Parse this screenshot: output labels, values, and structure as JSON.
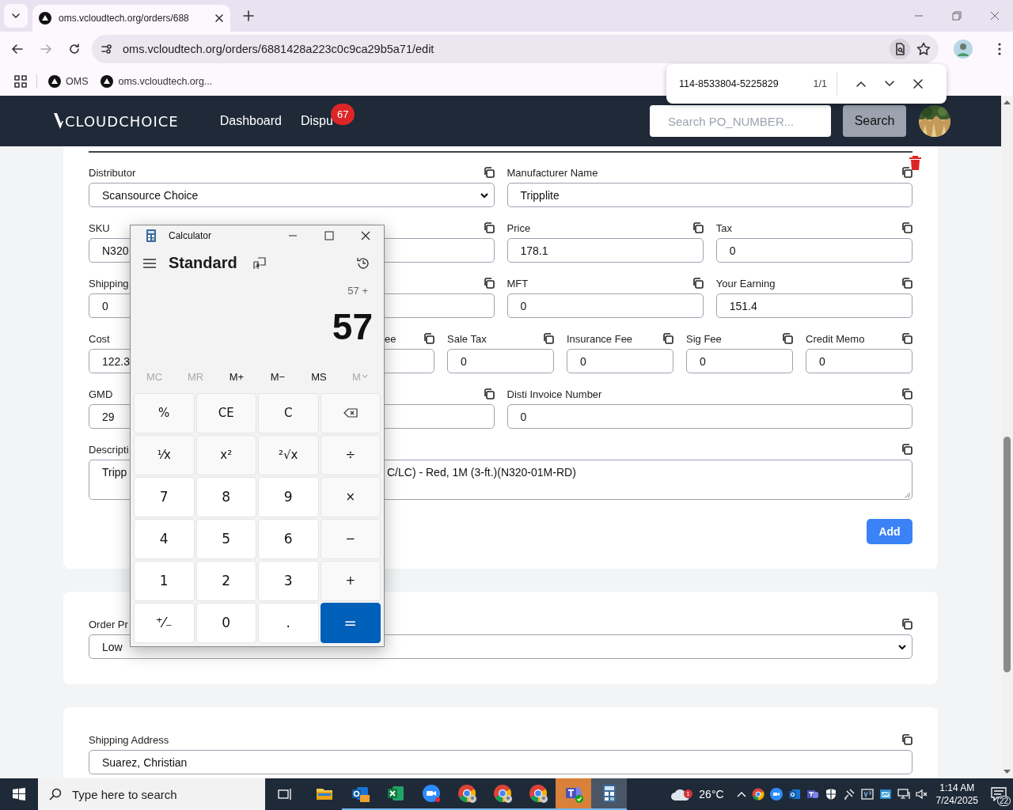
{
  "browser": {
    "tab_title": "oms.vcloudtech.org/orders/688",
    "url": "oms.vcloudtech.org/orders/6881428a223c0c9ca29b5a71/edit",
    "bookmarks": [
      "OMS",
      "oms.vcloudtech.org..."
    ],
    "find_bar": {
      "query": "114-8533804-5225829",
      "count": "1/1"
    }
  },
  "header": {
    "logo": "CLOUDCHOICE",
    "nav": [
      {
        "label": "Dashboard"
      },
      {
        "label": "Dispu",
        "badge": "67"
      }
    ],
    "search": {
      "placeholder": "Search PO_NUMBER..."
    },
    "search_button": "Search"
  },
  "order_card": {
    "rows": [
      {
        "fields": [
          {
            "kind": "select",
            "label": "Distributor",
            "value": "Scansource Choice"
          },
          {
            "kind": "input",
            "label": "Manufacturer Name",
            "value": "Tripplite"
          }
        ]
      },
      {
        "fields": [
          {
            "kind": "partial",
            "label": "SKU",
            "value": "N320"
          },
          {
            "kind": "covered"
          },
          {
            "kind": "input",
            "label": "Price",
            "value": "178.1"
          },
          {
            "kind": "input",
            "label": "Tax",
            "value": "0"
          }
        ]
      },
      {
        "fields": [
          {
            "kind": "partial",
            "label": "Shipping",
            "value": "0"
          },
          {
            "kind": "covered"
          },
          {
            "kind": "input",
            "label": "MFT",
            "value": "0"
          },
          {
            "kind": "input",
            "label": "Your Earning",
            "value": "151.4"
          }
        ]
      },
      {
        "fields": [
          {
            "kind": "partial",
            "label": "Cost",
            "value": "122.3"
          },
          {
            "kind": "hidden"
          },
          {
            "kind": "covered",
            "label": "ee"
          },
          {
            "kind": "input",
            "label": "Sale Tax",
            "value": "0"
          },
          {
            "kind": "input",
            "label": "Insurance Fee",
            "value": "0"
          },
          {
            "kind": "input",
            "label": "Sig Fee",
            "value": "0"
          },
          {
            "kind": "input",
            "label": "Credit Memo",
            "value": "0"
          }
        ]
      },
      {
        "fields": [
          {
            "kind": "partial",
            "label": "GMD",
            "value": "29"
          },
          {
            "kind": "covered"
          },
          {
            "kind": "input",
            "label": "Disti Invoice Number",
            "value": "0"
          }
        ]
      },
      {
        "fields": [
          {
            "kind": "textarea",
            "label": "Descripti",
            "value": "Tripp",
            "value_tail": "C/LC) - Red, 1M (3-ft.)(N320-01M-RD)"
          }
        ]
      }
    ],
    "add_button": "Add"
  },
  "priority_card": {
    "label": "Order Pr",
    "value": "Low"
  },
  "address_card": {
    "label": "Shipping Address",
    "value": "Suarez, Christian"
  },
  "calculator": {
    "title": "Calculator",
    "mode": "Standard",
    "expression": "57 +",
    "display": "57",
    "memory": [
      {
        "label": "MC",
        "disabled": true
      },
      {
        "label": "MR",
        "disabled": true
      },
      {
        "label": "M+",
        "disabled": false
      },
      {
        "label": "M−",
        "disabled": false
      },
      {
        "label": "MS",
        "disabled": false
      },
      {
        "label": "M",
        "disabled": true,
        "kind": "menu"
      }
    ],
    "keys": [
      {
        "label": "%",
        "kind": "fn"
      },
      {
        "label": "CE",
        "kind": "fn"
      },
      {
        "label": "C",
        "kind": "fn"
      },
      {
        "kind": "backspace"
      },
      {
        "label": "¹⁄x",
        "kind": "fn"
      },
      {
        "label": "x²",
        "kind": "fn"
      },
      {
        "label": "²√x",
        "kind": "fn"
      },
      {
        "label": "÷",
        "kind": "fn"
      },
      {
        "label": "7",
        "kind": "num"
      },
      {
        "label": "8",
        "kind": "num"
      },
      {
        "label": "9",
        "kind": "num"
      },
      {
        "label": "×",
        "kind": "fn"
      },
      {
        "label": "4",
        "kind": "num"
      },
      {
        "label": "5",
        "kind": "num"
      },
      {
        "label": "6",
        "kind": "num"
      },
      {
        "label": "−",
        "kind": "fn"
      },
      {
        "label": "1",
        "kind": "num"
      },
      {
        "label": "2",
        "kind": "num"
      },
      {
        "label": "3",
        "kind": "num"
      },
      {
        "label": "+",
        "kind": "fn"
      },
      {
        "label": "⁺⁄₋",
        "kind": "num"
      },
      {
        "label": "0",
        "kind": "num"
      },
      {
        "label": ".",
        "kind": "num"
      },
      {
        "label": "=",
        "kind": "equals"
      }
    ]
  },
  "taskbar": {
    "search_placeholder": "Type here to search",
    "apps": [
      {
        "kind": "folder",
        "running": false,
        "flashing": false,
        "selected": false
      },
      {
        "kind": "outlook",
        "running": true,
        "flashing": false,
        "selected": false
      },
      {
        "kind": "excel",
        "running": true,
        "flashing": false,
        "selected": false
      },
      {
        "kind": "zoom",
        "running": true,
        "flashing": false,
        "selected": false
      },
      {
        "kind": "chrome",
        "running": true,
        "flashing": false,
        "selected": false
      },
      {
        "kind": "chrome",
        "running": true,
        "flashing": false,
        "selected": false
      },
      {
        "kind": "chrome",
        "running": true,
        "flashing": false,
        "selected": false
      },
      {
        "kind": "teams",
        "running": true,
        "flashing": true,
        "selected": false
      },
      {
        "kind": "calculator",
        "running": true,
        "flashing": false,
        "selected": true
      }
    ],
    "weather_badge": "1",
    "weather": "26°C",
    "time": "1:14 AM",
    "date": "7/24/2025",
    "notifications": "22"
  }
}
